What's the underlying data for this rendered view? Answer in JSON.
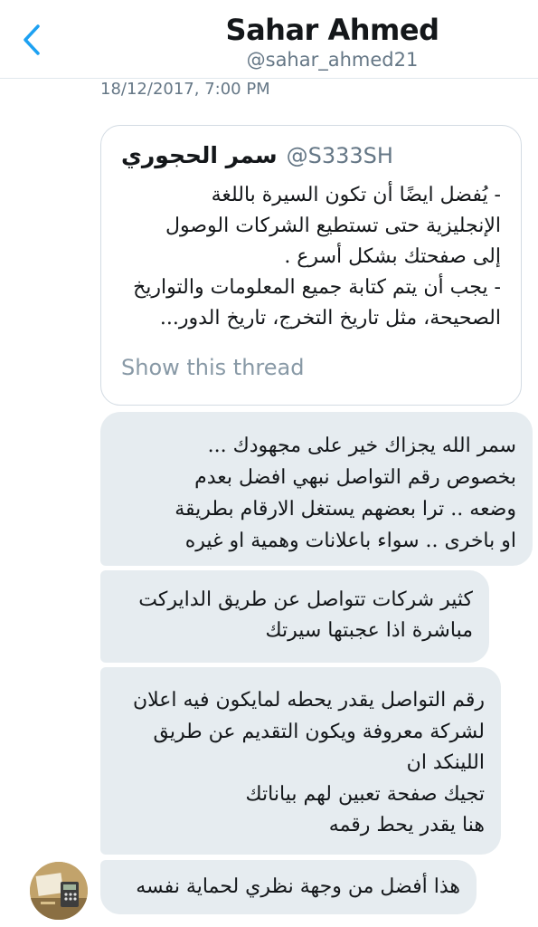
{
  "header": {
    "back_icon": "chevron-left-icon",
    "name": "Sahar Ahmed",
    "handle": "@sahar_ahmed21"
  },
  "message_timestamp": "18/12/2017, 7:00 PM",
  "quoted_tweet": {
    "author_name": "سمر الحجوري",
    "author_handle": "@S333SH",
    "text": "- يُفضل ايضًا أن تكون السيرة باللغة\nالإنجليزية حتى تستطيع الشركات الوصول\nإلى صفحتك بشكل أسرع .\n- يجب أن يتم كتابة جميع المعلومات والتواريخ\nالصحيحة، مثل تاريخ التخرج، تاريخ الدور...",
    "show_thread_label": "Show this thread"
  },
  "messages": [
    {
      "text": "سمر الله يجزاك خير على مجهودك ...\nبخصوص رقم التواصل نبهي افضل بعدم\nوضعه .. ترا بعضهم يستغل الارقام بطريقة\nاو باخرى .. سواء باعلانات وهمية او غيره"
    },
    {
      "text": "كثير شركات تتواصل عن طريق الدايركت\nمباشرة اذا عجبتها سيرتك"
    },
    {
      "text": "رقم التواصل يقدر يحطه لمايكون فيه اعلان\nلشركة معروفة ويكون التقديم عن طريق\nاللينكد ان\nتجيك صفحة تعبين لهم بياناتك\nهنا يقدر يحط رقمه"
    },
    {
      "text": "هذا أفضل من وجهة نظري لحماية نفسه"
    }
  ],
  "colors": {
    "accent": "#1da1f2",
    "bubble": "#e6ecf0",
    "muted": "#657786"
  }
}
